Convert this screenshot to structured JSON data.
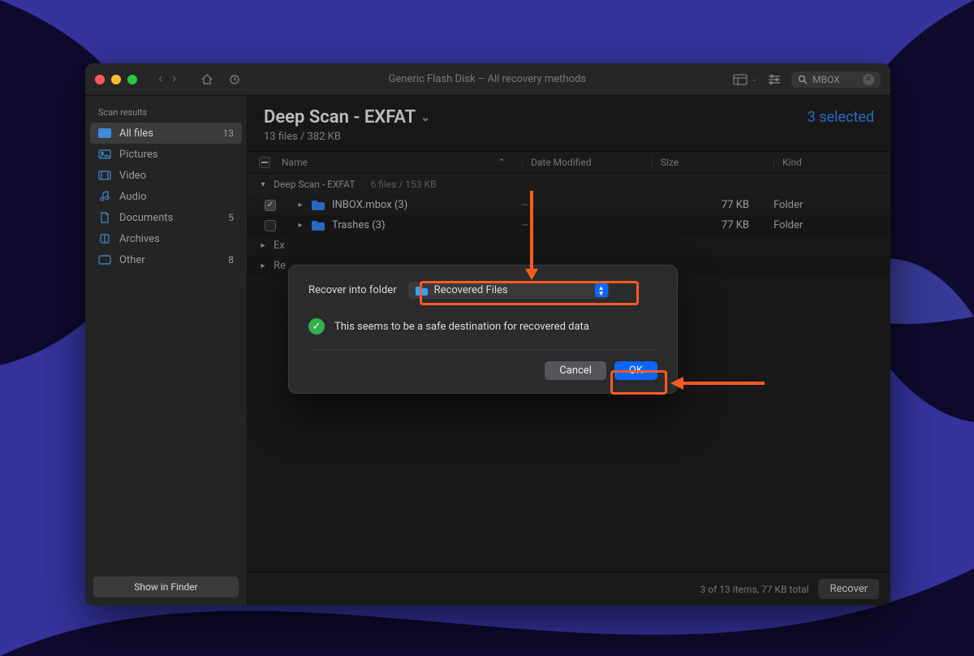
{
  "toolbar": {
    "title": "Generic Flash Disk – All recovery methods",
    "search_placeholder": "",
    "search_value": "MBOX"
  },
  "sidebar": {
    "section": "Scan results",
    "items": [
      {
        "icon": "all",
        "label": "All files",
        "count": "13",
        "active": true
      },
      {
        "icon": "pictures",
        "label": "Pictures",
        "count": ""
      },
      {
        "icon": "video",
        "label": "Video",
        "count": ""
      },
      {
        "icon": "audio",
        "label": "Audio",
        "count": ""
      },
      {
        "icon": "docs",
        "label": "Documents",
        "count": "5"
      },
      {
        "icon": "archives",
        "label": "Archives",
        "count": ""
      },
      {
        "icon": "other",
        "label": "Other",
        "count": "8"
      }
    ],
    "show_in_finder": "Show in Finder"
  },
  "header": {
    "title": "Deep Scan - EXFAT",
    "subtitle": "13 files / 382 KB",
    "selected": "3 selected"
  },
  "columns": {
    "name": "Name",
    "date": "Date Modified",
    "size": "Size",
    "kind": "Kind"
  },
  "group": {
    "label": "Deep Scan - EXFAT",
    "meta": "6 files / 153 KB"
  },
  "rows": [
    {
      "checked": true,
      "name": "INBOX.mbox (3)",
      "date": "--",
      "size": "77 KB",
      "kind": "Folder"
    },
    {
      "checked": false,
      "name": "Trashes (3)",
      "date": "--",
      "size": "77 KB",
      "kind": "Folder"
    }
  ],
  "stubs": [
    "Ex",
    "Re"
  ],
  "status": {
    "summary": "3 of 13 items, 77 KB total",
    "recover": "Recover"
  },
  "modal": {
    "label": "Recover into folder",
    "destination": "Recovered Files",
    "safe_msg": "This seems to be a safe destination for recovered data",
    "cancel": "Cancel",
    "ok": "OK"
  }
}
